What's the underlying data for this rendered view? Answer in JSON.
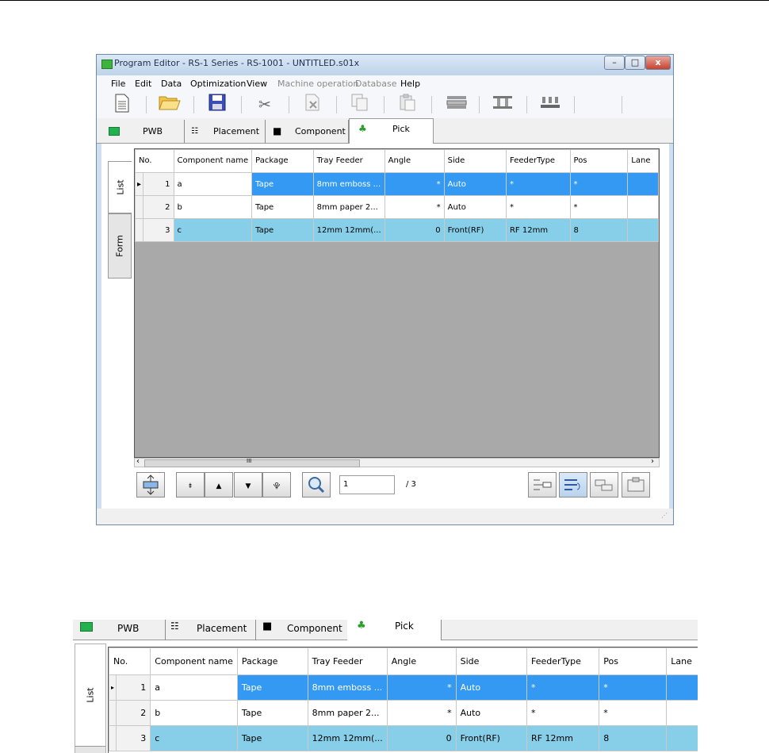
{
  "window": {
    "title": "Program Editor - RS-1 Series - RS-1001 - UNTITLED.s01x",
    "minimize": "–",
    "maximize": "□",
    "close": "x"
  },
  "menu": [
    "File",
    "Edit",
    "Data",
    "Optimization",
    "View",
    "Machine operation",
    "Database",
    "Help"
  ],
  "toolbar_icons": [
    "new-document-icon",
    "open-folder-icon",
    "save-icon",
    "cut-icon",
    "delete-icon",
    "copy-icon",
    "paste-icon",
    "feeder-icon",
    "nozzle-icon",
    "tray-icon"
  ],
  "tabs": {
    "pwb": "PWB",
    "placement": "Placement",
    "component": "Component",
    "pick": "Pick"
  },
  "side_tabs": {
    "list": "List",
    "form": "Form"
  },
  "table": {
    "columns": [
      "No.",
      "Component name",
      "Package",
      "Tray Feeder",
      "Angle",
      "Side",
      "FeederType",
      "Pos",
      "Lane"
    ],
    "rows": [
      {
        "no": "1",
        "name": "a",
        "package": "Tape",
        "feeder": "8mm emboss ...",
        "angle": "*",
        "side": "Auto",
        "type": "*",
        "pos": "*",
        "lane": ""
      },
      {
        "no": "2",
        "name": "b",
        "package": "Tape",
        "feeder": "8mm paper 2...",
        "angle": "*",
        "side": "Auto",
        "type": "*",
        "pos": "*",
        "lane": ""
      },
      {
        "no": "3",
        "name": "c",
        "package": "Tape",
        "feeder": "12mm 12mm(...",
        "angle": "0",
        "side": "Front(RF)",
        "type": "RF 12mm",
        "pos": "8",
        "lane": ""
      }
    ]
  },
  "scrollbar": {
    "left_arrow": "‹",
    "right_arrow": "›",
    "grip": "III"
  },
  "navigation": {
    "page_value": "1",
    "page_total": "/ 3",
    "first": "⯒",
    "prev": "▲",
    "next": "▼",
    "last": "⯓"
  },
  "colors": {
    "selected_row": "#3399f3",
    "highlight_row": "#87cfe8",
    "grid_background": "#a9a9a9"
  }
}
